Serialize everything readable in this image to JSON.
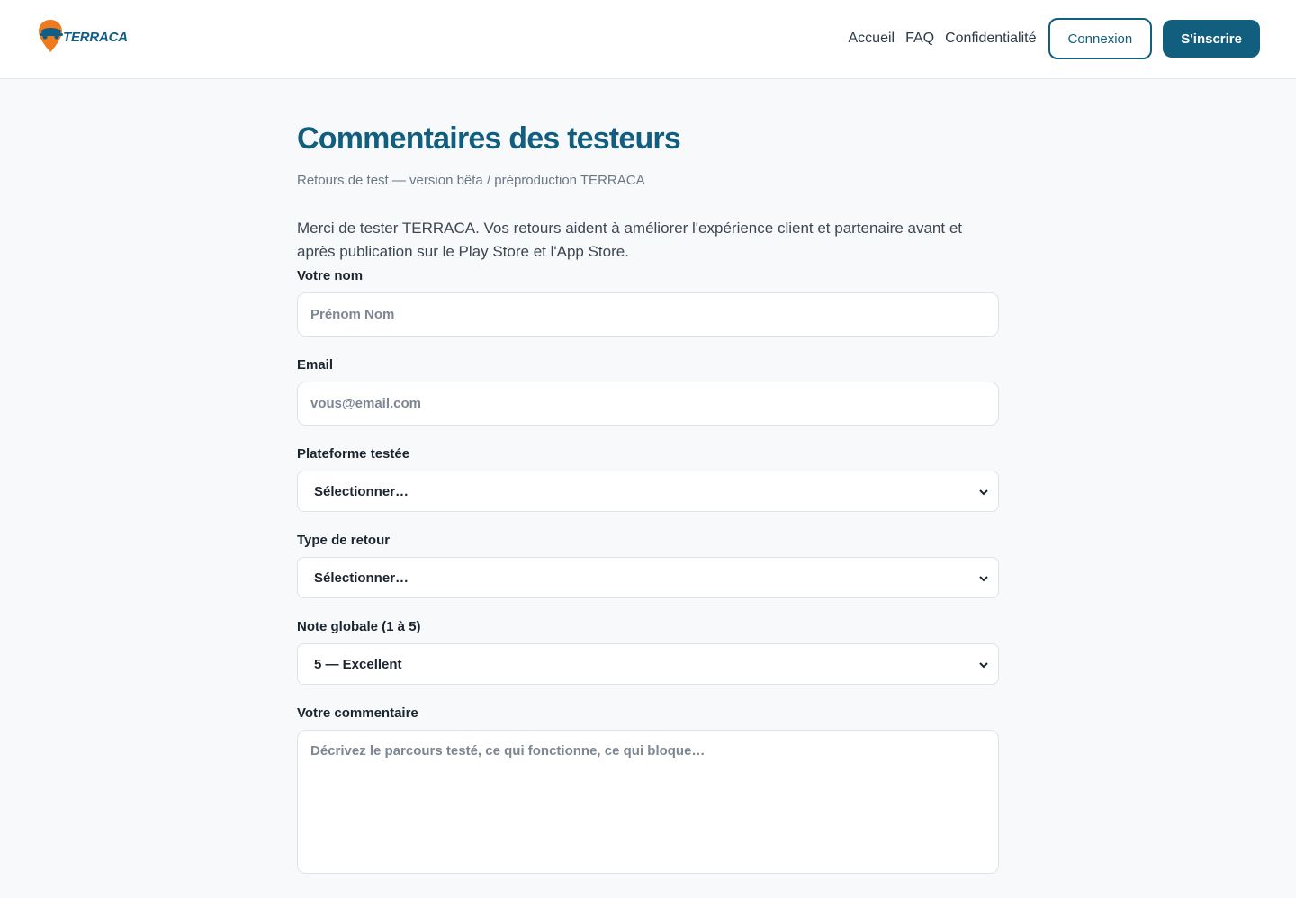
{
  "brand": {
    "name": "TERRACA",
    "primary_color": "#115e7f",
    "accent_color": "#f07b1f"
  },
  "nav": {
    "links": [
      "Accueil",
      "FAQ",
      "Confidentialité"
    ],
    "login_label": "Connexion",
    "signup_label": "S'inscrire"
  },
  "page": {
    "title": "Commentaires des testeurs",
    "subtitle": "Retours de test — version bêta / préproduction TERRACA",
    "intro": "Merci de tester TERRACA. Vos retours aident à améliorer l'expérience client et partenaire avant et après publication sur le Play Store et l'App Store."
  },
  "form": {
    "name": {
      "label": "Votre nom",
      "placeholder": "Prénom Nom",
      "value": ""
    },
    "email": {
      "label": "Email",
      "placeholder": "vous@email.com",
      "value": ""
    },
    "platform": {
      "label": "Plateforme testée",
      "selected": "Sélectionner…"
    },
    "feedback_type": {
      "label": "Type de retour",
      "selected": "Sélectionner…"
    },
    "rating": {
      "label": "Note globale (1 à 5)",
      "selected": "5 — Excellent"
    },
    "comment": {
      "label": "Votre commentaire",
      "placeholder": "Décrivez le parcours testé, ce qui fonctionne, ce qui bloque…",
      "value": ""
    }
  }
}
